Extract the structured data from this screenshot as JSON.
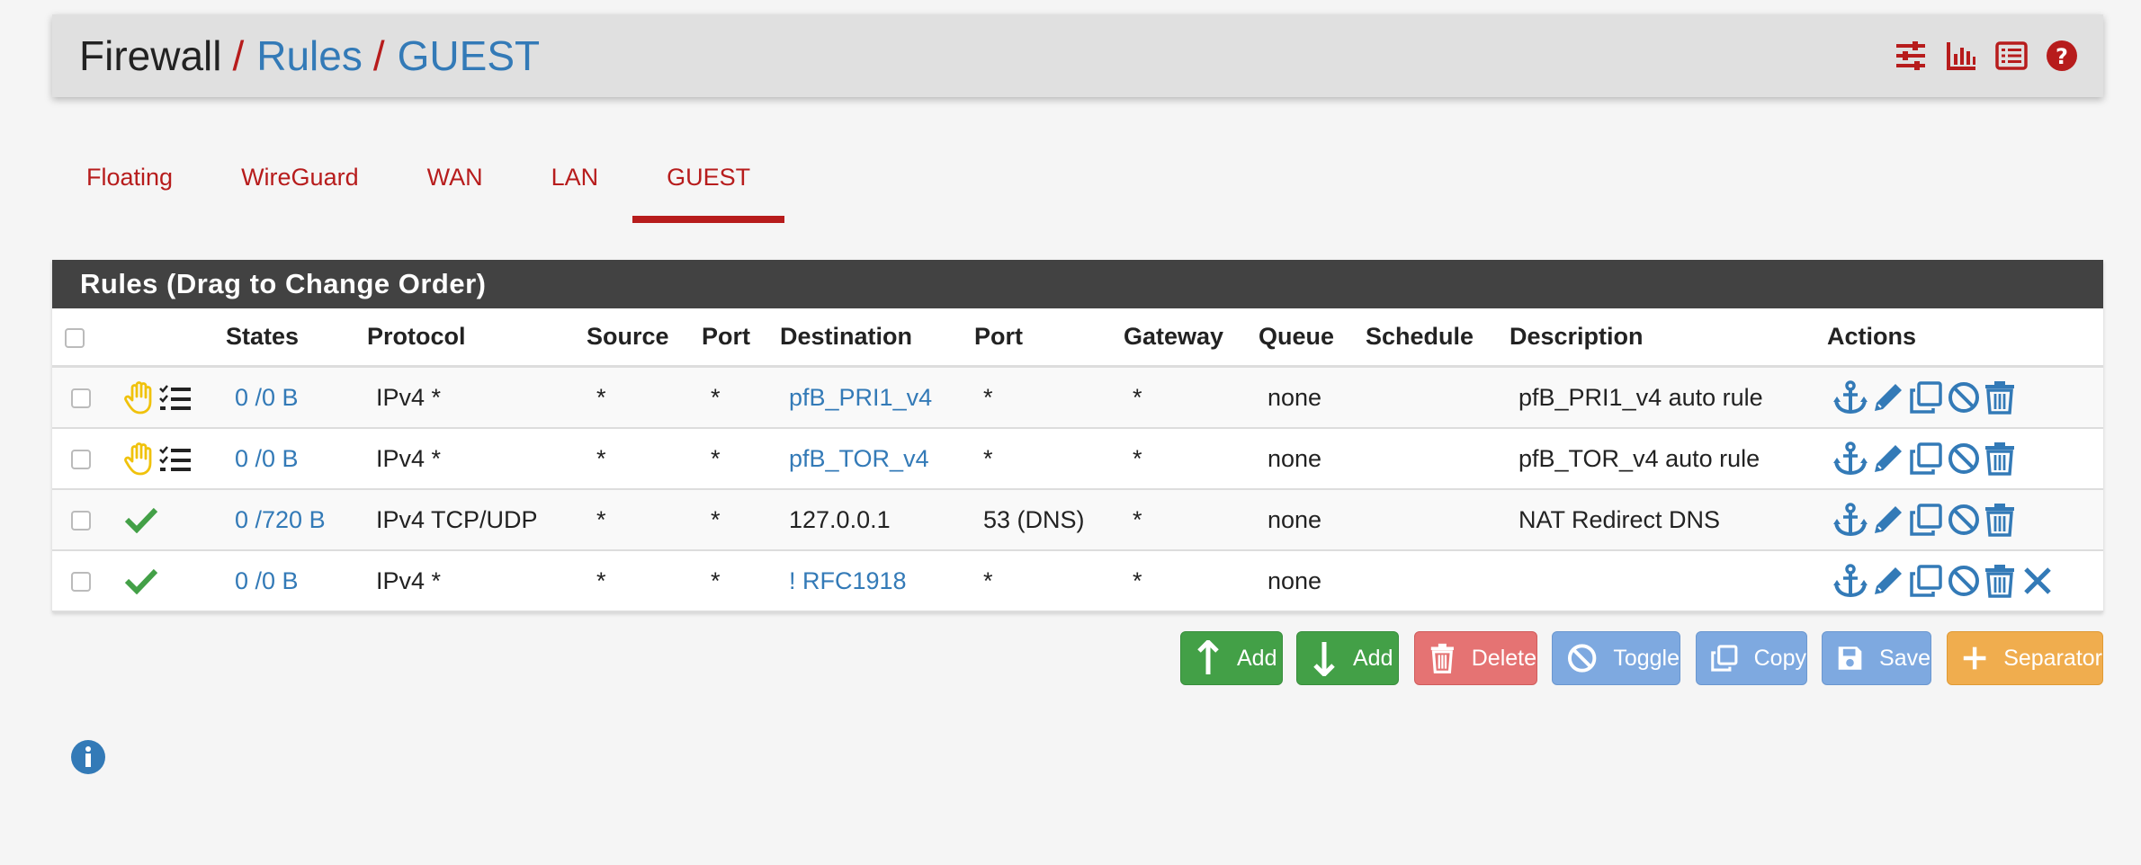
{
  "breadcrumb": {
    "first": "Firewall",
    "second": "Rules",
    "third": "GUEST",
    "separator": "/"
  },
  "header_icons": [
    "sliders-icon",
    "bar-chart-icon",
    "list-icon",
    "help-icon"
  ],
  "tabs": [
    {
      "label": "Floating",
      "active": false
    },
    {
      "label": "WireGuard",
      "active": false
    },
    {
      "label": "WAN",
      "active": false
    },
    {
      "label": "LAN",
      "active": false
    },
    {
      "label": "GUEST",
      "active": true
    }
  ],
  "panel": {
    "title": "Rules (Drag to Change Order)"
  },
  "columns": [
    "States",
    "Protocol",
    "Source",
    "Port",
    "Destination",
    "Port",
    "Gateway",
    "Queue",
    "Schedule",
    "Description",
    "Actions"
  ],
  "rows": [
    {
      "status_icon": "hand-icon",
      "states": "0 /0 B",
      "protocol": "IPv4 *",
      "source": "*",
      "src_port": "*",
      "destination": "pfB_PRI1_v4",
      "dst_port": "*",
      "gateway": "*",
      "queue": "none",
      "schedule": "",
      "description": "pfB_PRI1_v4 auto rule"
    },
    {
      "status_icon": "hand-icon",
      "states": "0 /0 B",
      "protocol": "IPv4 *",
      "source": "*",
      "src_port": "*",
      "destination": "pfB_TOR_v4",
      "dst_port": "*",
      "gateway": "*",
      "queue": "none",
      "schedule": "",
      "description": "pfB_TOR_v4 auto rule"
    },
    {
      "status_icon": "check-icon",
      "states": "0 /720 B",
      "protocol": "IPv4 TCP/UDP",
      "source": "*",
      "src_port": "*",
      "destination": "127.0.0.1",
      "dst_port": "53 (DNS)",
      "gateway": "*",
      "queue": "none",
      "schedule": "",
      "description": "NAT Redirect DNS"
    },
    {
      "status_icon": "check-icon",
      "states": "0 /0 B",
      "protocol": "IPv4 *",
      "source": "*",
      "src_port": "*",
      "destination": "! RFC1918",
      "dst_port": "*",
      "gateway": "*",
      "queue": "none",
      "schedule": "",
      "description": ""
    }
  ],
  "buttons": {
    "add_top": "Add",
    "add_bottom": "Add",
    "delete": "Delete",
    "toggle": "Toggle",
    "copy": "Copy",
    "save": "Save",
    "separator": "Separator"
  },
  "colors": {
    "accent_red": "#b71c1c",
    "link_blue": "#337ab7",
    "panel_head": "#424242",
    "green": "#43a047",
    "warn_yellow": "#f0c20c"
  }
}
